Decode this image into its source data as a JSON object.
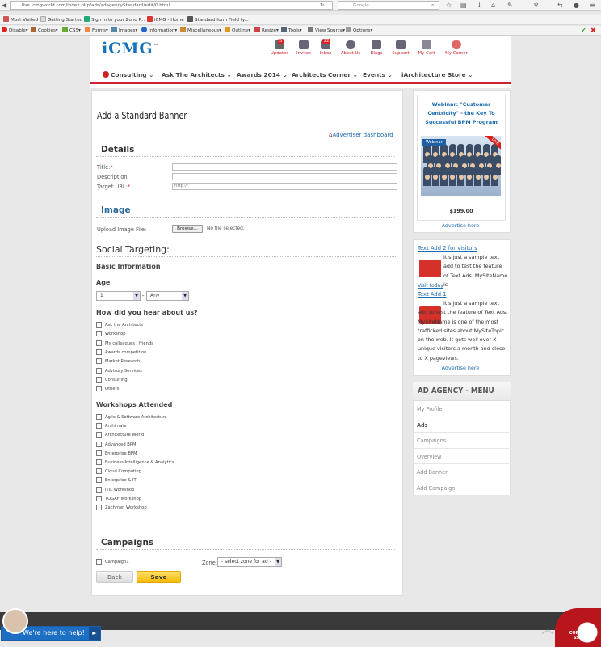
{
  "browser": {
    "url": "live.icmgworld.com/index.php/ads/adagencyStandard/edit/0.html",
    "search_placeholder": "Google",
    "bookmarks": [
      "Most Visited",
      "Getting Started",
      "Sign in to your Zoho P...",
      "iCMG - Home",
      "Standard form Field ty..."
    ],
    "devtools": [
      "Disable",
      "Cookies",
      "CSS",
      "Forms",
      "Images",
      "Information",
      "Miscellaneous",
      "Outline",
      "Resize",
      "Tools",
      "View Source",
      "Options"
    ]
  },
  "header": {
    "logo_text": "iCMG",
    "logo_tm": "™",
    "icons": [
      {
        "label": "Updates",
        "badge": "5"
      },
      {
        "label": "Invites",
        "badge": ""
      },
      {
        "label": "Inbox",
        "badge": "22"
      },
      {
        "label": "About Us",
        "badge": ""
      },
      {
        "label": "Blogs",
        "badge": ""
      },
      {
        "label": "Support",
        "badge": ""
      },
      {
        "label": "My Cart",
        "badge": ""
      },
      {
        "label": "My Corner",
        "badge": ""
      }
    ],
    "menu": [
      "Consulting",
      "Ask The Architects",
      "Awards 2014",
      "Architects Corner",
      "Events",
      "iArchitecture Store"
    ]
  },
  "form": {
    "title": "Add a Standard Banner",
    "advertiser_dashboard": "Advertiser dashboard",
    "details_heading": "Details",
    "title_label": "Title:",
    "description_label": "Description",
    "target_url_label": "Target URL:",
    "required_mark": "*",
    "target_url_value": "http://",
    "image_heading": "Image",
    "upload_label": "Upload Image File:",
    "browse_label": "Browse...",
    "no_file": "No file selected.",
    "social_heading": "Social Targeting:",
    "basic_info": "Basic Information",
    "age_label": "Age",
    "age_from": "1",
    "age_dash": "-",
    "age_to": "Any",
    "hear_label": "How did you hear about us?",
    "hear_options": [
      "Ask the Architects",
      "Workshop",
      "My colleagues / friends",
      "Awards competition",
      "Market Research",
      "Advisory Services",
      "Consulting",
      "Others"
    ],
    "workshops_label": "Workshops Attended",
    "workshop_options": [
      "Agile & Software Architecture",
      "Archimate",
      "Architecture World",
      "Advanced BPM",
      "Enterprise BPM",
      "Business Intelligence & Analytics",
      "Cloud Computing",
      "Enterprise & IT",
      "ITIL Workshop",
      "TOGAF Workshop",
      "Zachman Workshop"
    ],
    "campaigns_heading": "Campaigns",
    "campaign_name": "Campaign1",
    "zone_label": "Zone:",
    "zone_select": "- select zone for ad -",
    "back_label": "Back",
    "save_label": "Save"
  },
  "sidebar": {
    "webinar_title": "Webinar: \"Customer Centricity\" - the Key To Successful BPM Program",
    "webinar_tag": "Webinar",
    "live_tag": "Live",
    "webinar_price": "$199.00",
    "advertise_here": "Advertise here",
    "text_ads": [
      {
        "title": "Text Add 2 for visitors",
        "body": "It's just a sample text add to test the feature of Text Ads. MySiteName is",
        "link": "Visit today"
      },
      {
        "title": "Text Add 1",
        "body": "It's just a sample text add to test the feature of Text Ads. MySiteName is one of the most trafficked sites about MySiteTopic on the web. It gets well over X unique visitors a month and close to X pageviews.",
        "link": ""
      }
    ],
    "advertise_here_2": "Advertise here",
    "agency_menu_title": "AD AGENCY - MENU",
    "agency_menu": [
      "My Profile",
      "Ads",
      "Campaigns",
      "Overview",
      "Add Banner",
      "Add Campaign"
    ]
  },
  "footer": {
    "chat_label": "We're here to help!",
    "comodo_text": "COMODO EV SSL SITE"
  }
}
